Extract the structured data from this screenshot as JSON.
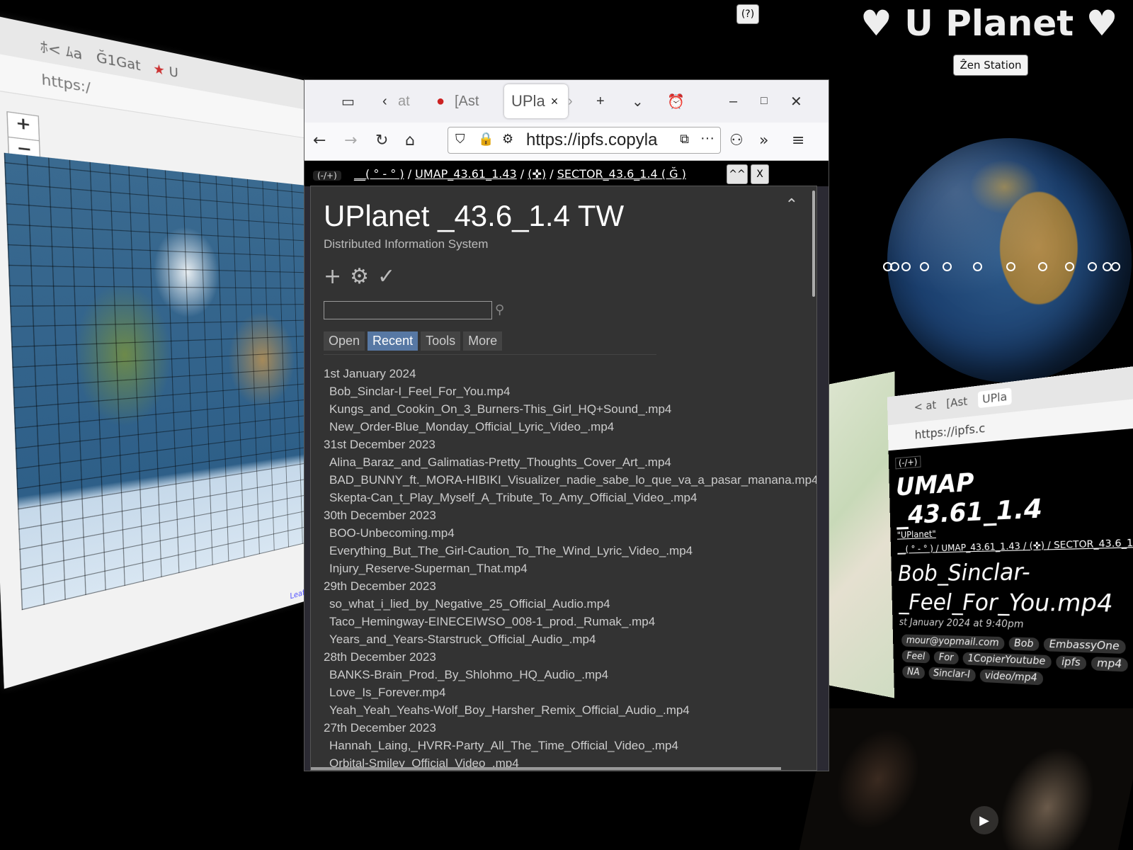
{
  "branding": {
    "help_label": "(?)",
    "title": "♥ U Planet ♥",
    "zen_label": "Ẑen Station"
  },
  "dots_count": 12,
  "left_window": {
    "tab_1": "ﾎ< ﾑa",
    "tab_2": "Ğ1Gat",
    "tab_3": "U",
    "url": "https:/",
    "zoom_in": "+",
    "zoom_out": "−",
    "attribution": "Leaflet | Ast"
  },
  "right_window": {
    "tab_a": "< at",
    "tab_b": "[Ast",
    "tab_c": "UPla",
    "url": "https://ipfs.c",
    "badge": "(-/+)",
    "umap_line1": "UMAP",
    "umap_line2": "_43.61_1.4",
    "uplanet_link": "\"UPlanet\"",
    "breadcrumb": "__( ° - ° ) / UMAP_43.61_1.43 / (✜) / SECTOR_43.6_1",
    "title_line1": "Bob_Sinclar-",
    "title_line2": "_Feel_For_You.mp4",
    "date": "st January 2024 at 9:40pm",
    "tags": [
      "mour@yopmail.com",
      "Bob",
      "EmbassyOne",
      "Feel",
      "For",
      "1CopierYoutube",
      "ipfs",
      "mp4",
      "NA",
      "Sinclar-I",
      "video/mp4"
    ]
  },
  "browser": {
    "tab_prev": "at",
    "tab_ast": "[Ast",
    "tab_active": "UPla",
    "tab_close": "×",
    "url": "https://ipfs.copyla",
    "nav": {
      "back": "←",
      "forward": "→",
      "reload": "↻",
      "home": "⌂",
      "overflow": "»",
      "menu": "≡",
      "dots": "···"
    }
  },
  "breadcrumb": {
    "badge": "(-/+)",
    "part1": "__( ° - ° )",
    "sep1": " / ",
    "part2": "UMAP_43.61_1.43",
    "sep2": " / ",
    "part3": "(✜)",
    "sep3": " / ",
    "part4": "SECTOR_43.6_1.4 ( Ğ )",
    "btn_up": "^^",
    "btn_close": "X"
  },
  "panel": {
    "title": "UPlanet _43.6_1.4 TW",
    "subtitle": "Distributed Information System",
    "tabs": [
      "Open",
      "Recent",
      "Tools",
      "More"
    ],
    "active_tab": "Recent",
    "search_placeholder": ""
  },
  "recent": [
    {
      "date": "1st January 2024",
      "items": [
        "Bob_Sinclar-I_Feel_For_You.mp4",
        "Kungs_and_Cookin_On_3_Burners-This_Girl_HQ+Sound_.mp4",
        "New_Order-Blue_Monday_Official_Lyric_Video_.mp4"
      ]
    },
    {
      "date": "31st December 2023",
      "items": [
        "Alina_Baraz_and_Galimatias-Pretty_Thoughts_Cover_Art_.mp4",
        "BAD_BUNNY_ft._MORA-HIBIKI_Visualizer_nadie_sabe_lo_que_va_a_pasar_manana.mp4",
        "Skepta-Can_t_Play_Myself_A_Tribute_To_Amy_Official_Video_.mp4"
      ]
    },
    {
      "date": "30th December 2023",
      "items": [
        "BOO-Unbecoming.mp4",
        "Everything_But_The_Girl-Caution_To_The_Wind_Lyric_Video_.mp4",
        "Injury_Reserve-Superman_That.mp4"
      ]
    },
    {
      "date": "29th December 2023",
      "items": [
        "so_what_i_lied_by_Negative_25_Official_Audio.mp4",
        "Taco_Hemingway-EINECEIWSO_008-1_prod._Rumak_.mp4",
        "Years_and_Years-Starstruck_Official_Audio_.mp4"
      ]
    },
    {
      "date": "28th December 2023",
      "items": [
        "BANKS-Brain_Prod._By_Shlohmo_HQ_Audio_.mp4",
        "Love_Is_Forever.mp4",
        "Yeah_Yeah_Yeahs-Wolf_Boy_Harsher_Remix_Official_Audio_.mp4"
      ]
    },
    {
      "date": "27th December 2023",
      "items": [
        "Hannah_Laing,_HVRR-Party_All_The_Time_Official_Video_.mp4",
        "Orbital-Smiley_Official_Video_.mp4"
      ]
    }
  ]
}
